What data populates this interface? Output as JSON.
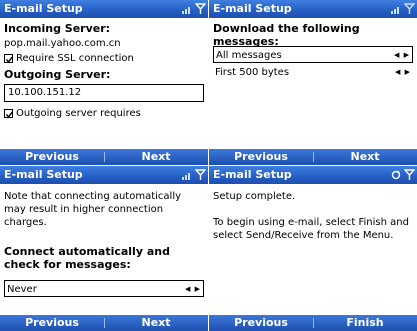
{
  "panel1": {
    "title": "E-mail Setup",
    "incoming_label": "Incoming Server:",
    "incoming_value": "pop.mail.yahoo.com.cn",
    "ssl_label": "Require SSL connection",
    "ssl_checked": true,
    "outgoing_label": "Outgoing Server:",
    "outgoing_value": "10.100.151.12",
    "outgoing_auth_label": "Outgoing server requires",
    "softkey_left": "Previous",
    "softkey_right": "Next"
  },
  "panel2": {
    "title": "E-mail Setup",
    "heading": "Download the following messages:",
    "selected_option": "All messages",
    "second_option": "First 500 bytes",
    "softkey_left": "Previous",
    "softkey_right": "Next"
  },
  "panel3": {
    "title": "E-mail Setup",
    "note": "Note that connecting automatically may result in higher connection charges.",
    "connect_label": "Connect automatically and check for messages:",
    "connect_value": "Never",
    "softkey_left": "Previous",
    "softkey_right": "Next"
  },
  "panel4": {
    "title": "E-mail Setup",
    "complete": "Setup complete.",
    "instructions": "To begin using e-mail, select Finish and select Send/Receive from the Menu.",
    "softkey_left": "Previous",
    "softkey_right": "Finish"
  },
  "colors": {
    "titlebar": "#2760c6",
    "softkeys": "#1e4fae"
  }
}
